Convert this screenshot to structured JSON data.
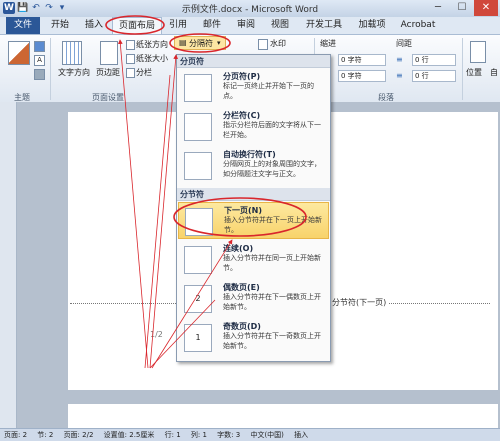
{
  "window": {
    "title": "示例文件.docx - Microsoft Word",
    "logo": "W",
    "quick_access": [
      "💾",
      "↶",
      "↷",
      "▾"
    ],
    "controls": [
      "─",
      "☐",
      "✕"
    ]
  },
  "tabs": [
    "文件",
    "开始",
    "插入",
    "页面布局",
    "引用",
    "邮件",
    "审阅",
    "视图",
    "开发工具",
    "加载项",
    "Acrobat"
  ],
  "ribbon": {
    "theme_label": "主题",
    "text_direction": "文字方向",
    "margins": "页边距",
    "orientation": "纸张方向",
    "size": "纸张大小",
    "columns": "分栏",
    "page_setup_group": "页面设置",
    "breaks_button": "分隔符",
    "watermark": "水印",
    "indent_label": "缩进",
    "spacing_label": "间距",
    "indent_left": "0 字符",
    "indent_right": "0 字符",
    "spacing_before": "0 行",
    "spacing_after": "0 行",
    "paragraph_group": "段落",
    "position": "位置",
    "auto_wrap": "自"
  },
  "menu": {
    "page_break_section": "分页符",
    "section_break_section": "分节符",
    "items": [
      {
        "title": "分页符(P)",
        "desc": "标记一页终止并开始下一页的点。"
      },
      {
        "title": "分栏符(C)",
        "desc": "指示分栏符后面的文字将从下一栏开始。"
      },
      {
        "title": "自动换行符(T)",
        "desc": "分隔网页上的对象周围的文字，如分隔题注文字与正文。"
      },
      {
        "title": "下一页(N)",
        "desc": "插入分节符并在下一页上开始新节。"
      },
      {
        "title": "连续(O)",
        "desc": "插入分节符并在同一页上开始新节。"
      },
      {
        "title": "偶数页(E)",
        "desc": "插入分节符并在下一偶数页上开始新节。"
      },
      {
        "title": "奇数页(D)",
        "desc": "插入分节符并在下一奇数页上开始新节。"
      }
    ]
  },
  "document": {
    "section_break_label": "分节符(下一页)",
    "page_label": "1/2",
    "para_mark": "↵"
  },
  "status_bar": [
    "页面: 2",
    "节: 2",
    "页面: 2/2",
    "设置值: 2.5厘米",
    "行: 1",
    "列: 1",
    "字数: 3",
    "中文(中国)",
    "插入"
  ],
  "annotation_color": "#d9262c"
}
